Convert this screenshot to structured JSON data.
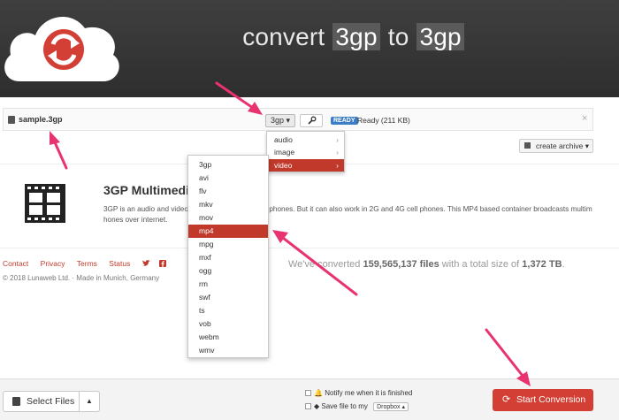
{
  "header": {
    "title_prefix": "convert",
    "from_format": "3gp",
    "title_joiner": "to",
    "to_format": "3gp",
    "logo_icon": "cloud-refresh-icon"
  },
  "file": {
    "name": "sample.3gp",
    "format_button": "3gp ▾",
    "status_badge": "READY",
    "status_text": "Ready (211 KB)",
    "close_glyph": "×"
  },
  "category_menu": {
    "items": [
      {
        "label": "audio",
        "arrow": "›"
      },
      {
        "label": "image",
        "arrow": "›"
      },
      {
        "label": "video",
        "arrow": "›"
      }
    ],
    "active": "video"
  },
  "format_menu": {
    "items": [
      "3gp",
      "avi",
      "flv",
      "mkv",
      "mov",
      "mp4",
      "mpg",
      "mxf",
      "ogg",
      "rm",
      "swf",
      "ts",
      "vob",
      "webm",
      "wmv"
    ],
    "active": "mp4"
  },
  "archive_button": "create archive ▾",
  "info": {
    "title": "3GP Multimedi",
    "description": "3GP is an audio and video c                               nerally used in 3G cell phones. But it can also work in 2G and 4G cell phones. This MP4 based container broadcasts multim                               hones over internet."
  },
  "footer": {
    "links": [
      "Contact",
      "Privacy",
      "Terms",
      "Status"
    ],
    "social_icons": [
      "twitter-icon",
      "facebook-icon"
    ],
    "copyright": "© 2018 Lunaweb Ltd. · Made in Munich, Germany",
    "stats_prefix": "We've converted",
    "stats_files": "159,565,137 files",
    "stats_mid": "with a total size of",
    "stats_size": "1,372 TB",
    "stats_suffix": "."
  },
  "bottom": {
    "select_files": "Select Files",
    "caret": "▲",
    "notify_label": "Notify me when it is finished",
    "save_label": "Save file to my",
    "dropbox": "Dropbox ▴",
    "start": "Start Conversion"
  },
  "colors": {
    "accent_red": "#d33f34",
    "arrow_pink": "#e8336f",
    "header_bg": "#333333",
    "ready_blue": "#3a7dc4"
  }
}
